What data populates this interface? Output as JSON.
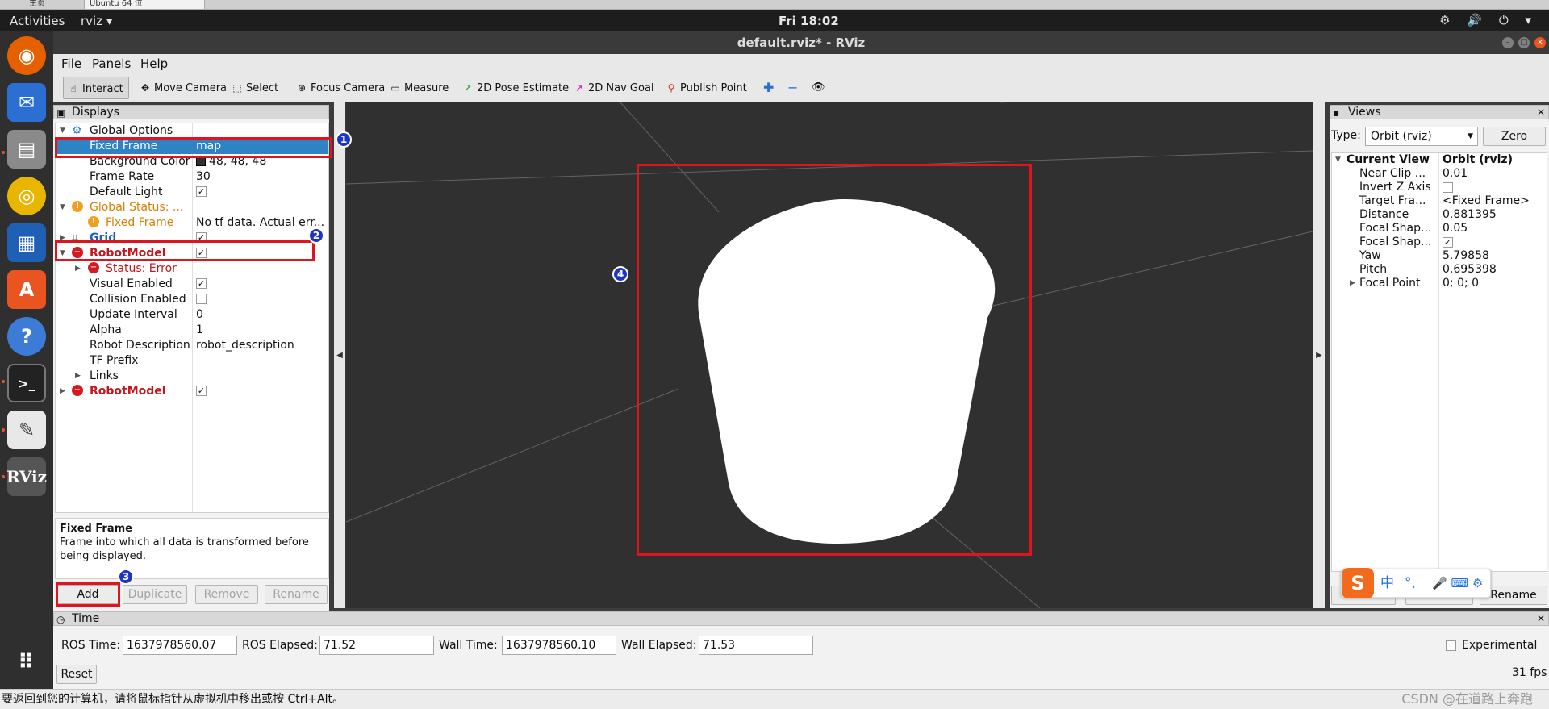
{
  "vm_tabs": {
    "tab1": "主页",
    "tab2": "Ubuntu 64 位"
  },
  "topbar": {
    "activities": "Activities",
    "app_menu": "rviz ▾",
    "clock": "Fri 18:02",
    "tray": "⚙ 🔊 ⏻ ▾"
  },
  "dock": {
    "apps": [
      "firefox-icon",
      "thunderbird-icon",
      "files-icon",
      "rhythmbox-icon",
      "libreoffice-writer-icon",
      "software-center-icon",
      "help-icon",
      "terminal-icon",
      "text-editor-icon",
      "rviz-icon",
      "show-apps-icon"
    ],
    "rviz_label": "RViz"
  },
  "window": {
    "title": "default.rviz* - RViz"
  },
  "menu": {
    "file": "File",
    "panels": "Panels",
    "help": "Help"
  },
  "toolbar": {
    "interact": "Interact",
    "move_camera": "Move Camera",
    "select": "Select",
    "focus_camera": "Focus Camera",
    "measure": "Measure",
    "pose_estimate": "2D Pose Estimate",
    "nav_goal": "2D Nav Goal",
    "publish_point": "Publish Point"
  },
  "displays": {
    "header": "Displays",
    "rows": {
      "global_options": "Global Options",
      "fixed_frame": "Fixed Frame",
      "fixed_frame_value": "map",
      "background_color": "Background Color",
      "background_color_value": "48, 48, 48",
      "frame_rate": "Frame Rate",
      "frame_rate_value": "30",
      "default_light": "Default Light",
      "global_status": "Global Status: ...",
      "gs_fixed_frame": "Fixed Frame",
      "gs_fixed_frame_value": "No tf data.  Actual err...",
      "grid": "Grid",
      "robot_model": "RobotModel",
      "status_error": "Status: Error",
      "visual_enabled": "Visual Enabled",
      "collision_enabled": "Collision Enabled",
      "update_interval": "Update Interval",
      "update_interval_value": "0",
      "alpha": "Alpha",
      "alpha_value": "1",
      "robot_description": "Robot Description",
      "robot_description_value": "robot_description",
      "tf_prefix": "TF Prefix",
      "links": "Links",
      "robot_model_2": "RobotModel"
    },
    "checks": {
      "default_light": "✓",
      "grid": "✓",
      "robot_model": "✓",
      "visual_enabled": "✓",
      "collision_enabled": "",
      "robot_model_2": "✓"
    },
    "description_title": "Fixed Frame",
    "description_text": "Frame into which all data is transformed before being displayed.",
    "buttons": {
      "add": "Add",
      "duplicate": "Duplicate",
      "remove": "Remove",
      "rename": "Rename"
    }
  },
  "views": {
    "header": "Views",
    "type_label": "Type:",
    "type_value": "Orbit (rviz)",
    "zero": "Zero",
    "rows": [
      {
        "name": "Current View",
        "value": "Orbit (rviz)"
      },
      {
        "name": "Near Clip ...",
        "value": "0.01"
      },
      {
        "name": "Invert Z Axis",
        "value": ""
      },
      {
        "name": "Target Fra...",
        "value": "<Fixed Frame>"
      },
      {
        "name": "Distance",
        "value": "0.881395"
      },
      {
        "name": "Focal Shap...",
        "value": "0.05"
      },
      {
        "name": "Focal Shap...",
        "value": "✓"
      },
      {
        "name": "Yaw",
        "value": "5.79858"
      },
      {
        "name": "Pitch",
        "value": "0.695398"
      },
      {
        "name": "Focal Point",
        "value": "0; 0; 0"
      }
    ],
    "buttons": {
      "save": "Save",
      "remove": "Remove",
      "rename": "Rename"
    }
  },
  "ime": {
    "lang": "中",
    "punct": "°,",
    "icons": "🎤 ⌨ ⚙"
  },
  "time": {
    "header": "Time",
    "ros_time_label": "ROS Time:",
    "ros_time": "1637978560.07",
    "ros_elapsed_label": "ROS Elapsed:",
    "ros_elapsed": "71.52",
    "wall_time_label": "Wall Time:",
    "wall_time": "1637978560.10",
    "wall_elapsed_label": "Wall Elapsed:",
    "wall_elapsed": "71.53",
    "experimental": "Experimental",
    "reset": "Reset",
    "fps": "31 fps"
  },
  "status_bar": {
    "text": "要返回到您的计算机，请将鼠标指针从虚拟机中移出或按 Ctrl+Alt。",
    "watermark": "CSDN @在道路上奔跑"
  },
  "annotations": {
    "b1": "1",
    "b2": "2",
    "b3": "3",
    "b4": "4"
  },
  "colors": {
    "background_swatch": "#303030",
    "selection": "#2f83c5",
    "error": "#c4161c",
    "annotation_box": "#e0141c",
    "annotation_badge": "#1d33c9"
  }
}
